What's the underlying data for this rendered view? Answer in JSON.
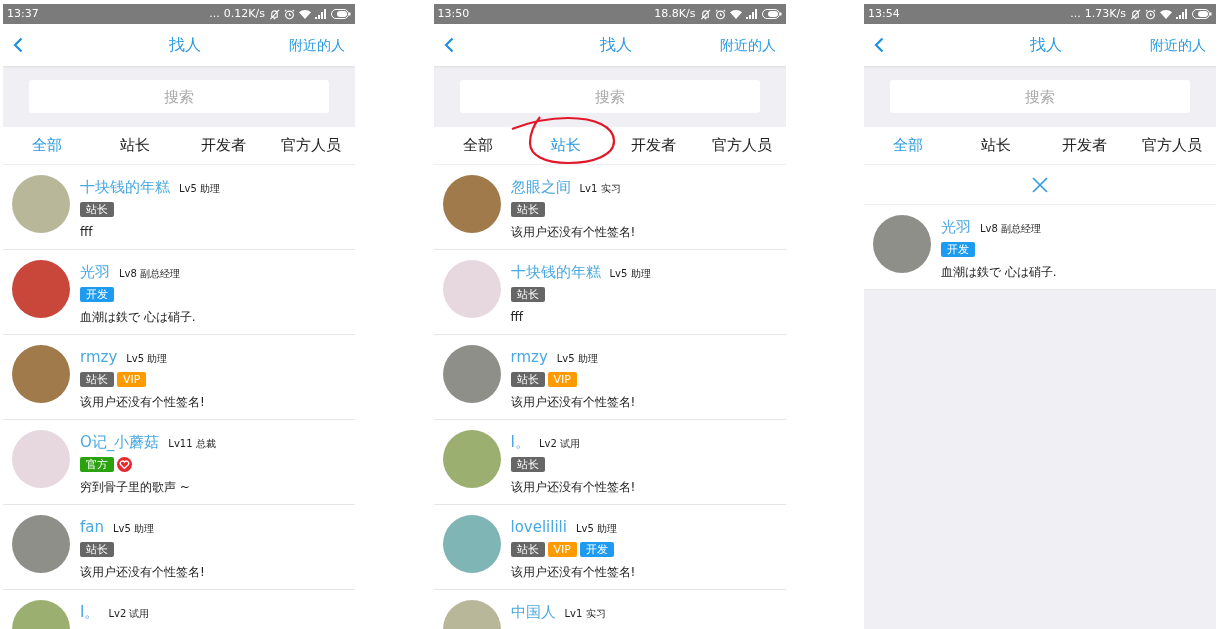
{
  "phones": [
    {
      "status_bar": {
        "time": "13:37",
        "dots": "...",
        "speed": "0.12K/s"
      },
      "header": {
        "title": "找人",
        "action": "附近的人"
      },
      "search": {
        "placeholder": "搜索"
      },
      "tabs": [
        {
          "label": "全部",
          "selected": true
        },
        {
          "label": "站长",
          "selected": false
        },
        {
          "label": "开发者",
          "selected": false
        },
        {
          "label": "官方人员",
          "selected": false
        }
      ],
      "annotated_tab": false,
      "clear_filter": false,
      "users": [
        {
          "name": "十块钱的年糕",
          "level": "Lv5 助理",
          "badges": [
            {
              "kind": "owner",
              "label": "站长"
            }
          ],
          "signature": "fff"
        },
        {
          "name": "光羽",
          "level": "Lv8 副总经理",
          "badges": [
            {
              "kind": "dev",
              "label": "开发"
            }
          ],
          "signature": "血潮は鉄で 心は硝子."
        },
        {
          "name": "rmzy",
          "level": "Lv5 助理",
          "badges": [
            {
              "kind": "owner",
              "label": "站长"
            },
            {
              "kind": "vip",
              "label": "VIP"
            }
          ],
          "signature": "该用户还没有个性签名!"
        },
        {
          "name": "O记_小蘑菇",
          "level": "Lv11 总裁",
          "badges": [
            {
              "kind": "official",
              "label": "官方"
            },
            {
              "kind": "heart"
            }
          ],
          "signature": "穷到骨子里的歌声 ~"
        },
        {
          "name": "fan",
          "level": "Lv5 助理",
          "badges": [
            {
              "kind": "owner",
              "label": "站长"
            }
          ],
          "signature": "该用户还没有个性签名!"
        },
        {
          "name": "I。",
          "level": "Lv2 试用"
        }
      ]
    },
    {
      "status_bar": {
        "time": "13:50",
        "speed": "18.8K/s"
      },
      "header": {
        "title": "找人",
        "action": "附近的人"
      },
      "search": {
        "placeholder": "搜索"
      },
      "tabs": [
        {
          "label": "全部",
          "selected": false
        },
        {
          "label": "站长",
          "selected": true
        },
        {
          "label": "开发者",
          "selected": false
        },
        {
          "label": "官方人员",
          "selected": false
        }
      ],
      "annotated_tab": true,
      "clear_filter": false,
      "users": [
        {
          "name": "忽眼之间",
          "level": "Lv1 实习",
          "badges": [
            {
              "kind": "owner",
              "label": "站长"
            }
          ],
          "signature": "该用户还没有个性签名!"
        },
        {
          "name": "十块钱的年糕",
          "level": "Lv5 助理",
          "badges": [
            {
              "kind": "owner",
              "label": "站长"
            }
          ],
          "signature": "fff"
        },
        {
          "name": "rmzy",
          "level": "Lv5 助理",
          "badges": [
            {
              "kind": "owner",
              "label": "站长"
            },
            {
              "kind": "vip",
              "label": "VIP"
            }
          ],
          "signature": "该用户还没有个性签名!"
        },
        {
          "name": "I。",
          "level": "Lv2 试用",
          "badges": [
            {
              "kind": "owner",
              "label": "站长"
            }
          ],
          "signature": "该用户还没有个性签名!"
        },
        {
          "name": "lovelilili",
          "level": "Lv5 助理",
          "badges": [
            {
              "kind": "owner",
              "label": "站长"
            },
            {
              "kind": "vip",
              "label": "VIP"
            },
            {
              "kind": "dev",
              "label": "开发"
            }
          ],
          "signature": "该用户还没有个性签名!"
        },
        {
          "name": "中国人",
          "level": "Lv1 实习"
        }
      ]
    },
    {
      "status_bar": {
        "time": "13:54",
        "dots": "...",
        "speed": "1.73K/s"
      },
      "header": {
        "title": "找人",
        "action": "附近的人"
      },
      "search": {
        "placeholder": "搜索"
      },
      "tabs": [
        {
          "label": "全部",
          "selected": true
        },
        {
          "label": "站长",
          "selected": false
        },
        {
          "label": "开发者",
          "selected": false
        },
        {
          "label": "官方人员",
          "selected": false
        }
      ],
      "annotated_tab": false,
      "clear_filter": true,
      "users": [
        {
          "name": "光羽",
          "level": "Lv8 副总经理",
          "badges": [
            {
              "kind": "dev",
              "label": "开发"
            }
          ],
          "signature": "血潮は鉄で 心は硝子."
        }
      ]
    }
  ]
}
